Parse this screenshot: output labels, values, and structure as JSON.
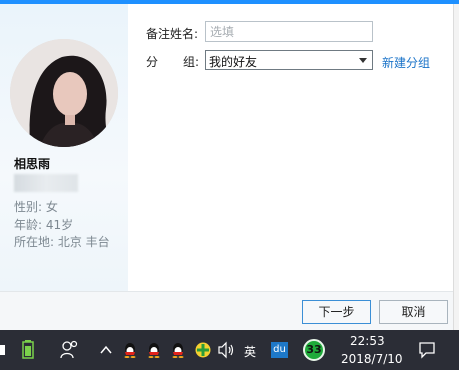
{
  "profile": {
    "nickname": "相思雨",
    "gender": "性别: 女",
    "age": "年龄: 41岁",
    "location": "所在地: 北京  丰台"
  },
  "form": {
    "remark_label": "备注姓名:",
    "remark_placeholder": "选填",
    "group_label_1": "分",
    "group_label_2": "组:",
    "group_selected": "我的好友",
    "new_group_link": "新建分组"
  },
  "buttons": {
    "next": "下一步",
    "cancel": "取消"
  },
  "taskbar": {
    "ime_label": "英",
    "du_label": "du",
    "badge_count": "33",
    "time": "22:53",
    "date": "2018/7/10"
  },
  "colors": {
    "accent": "#1e90ff",
    "link": "#1a73c8",
    "taskbar": "#2b2d36"
  }
}
